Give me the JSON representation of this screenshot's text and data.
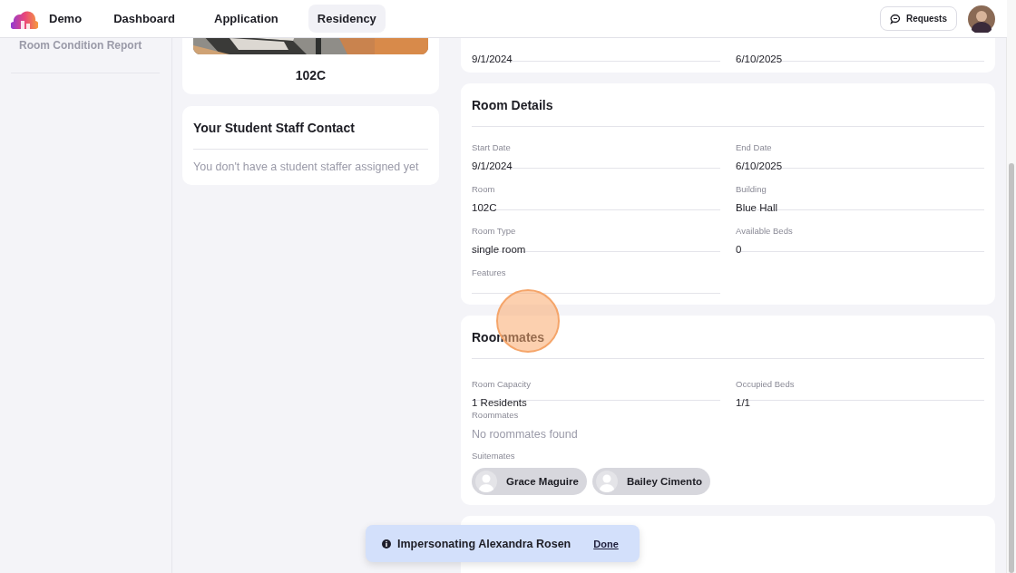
{
  "header": {
    "brand": "Demo",
    "nav": [
      {
        "label": "Dashboard",
        "selected": false
      },
      {
        "label": "Application",
        "selected": false
      },
      {
        "label": "Residency",
        "selected": true
      }
    ],
    "requests_button": "Requests"
  },
  "sidebar": {
    "items": [
      "Room Condition Report"
    ]
  },
  "room_card": {
    "room_number": "102C"
  },
  "staff_contact": {
    "title": "Your Student Staff Contact",
    "message": "You don't have a student staffer assigned yet"
  },
  "assignment_card": {
    "fields": [
      {
        "value": "9/1/2024"
      },
      {
        "value": "6/10/2025"
      }
    ]
  },
  "room_details": {
    "title": "Room Details",
    "fields": [
      {
        "label": "Start Date",
        "value": "9/1/2024"
      },
      {
        "label": "End Date",
        "value": "6/10/2025"
      },
      {
        "label": "Room",
        "value": "102C"
      },
      {
        "label": "Building",
        "value": "Blue Hall"
      },
      {
        "label": "Room Type",
        "value": "single room"
      },
      {
        "label": "Available Beds",
        "value": "0"
      },
      {
        "label": "Features"
      }
    ]
  },
  "roommates": {
    "title": "Roommates",
    "fields": [
      {
        "label": "Room Capacity",
        "value": "1 Residents"
      },
      {
        "label": "Occupied Beds",
        "value": "1/1"
      }
    ],
    "roommates_label": "Roommates",
    "roommates_empty": "No roommates found",
    "suitemates_label": "Suitemates",
    "suitemates": [
      {
        "name": "Grace Maguire"
      },
      {
        "name": "Bailey Cimento"
      }
    ]
  },
  "toast": {
    "message": "Impersonating Alexandra Rosen",
    "action": "Done"
  }
}
